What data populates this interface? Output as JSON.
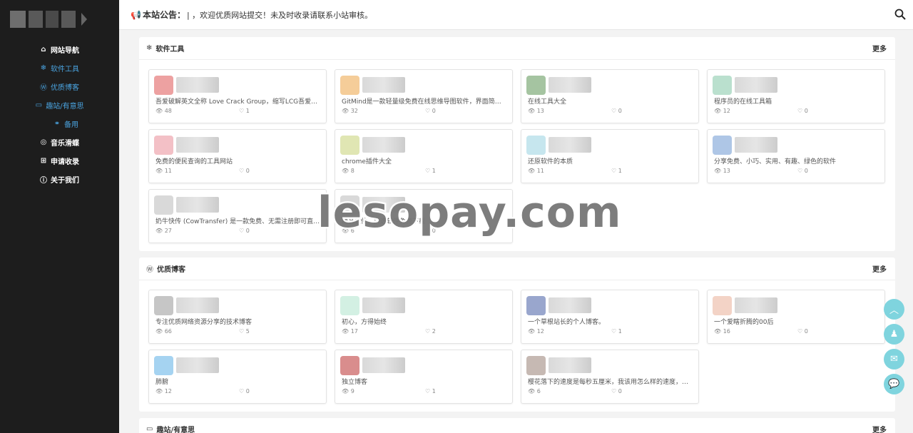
{
  "sidebar": {
    "items": [
      {
        "icon": "home-icon",
        "glyph": "🏠",
        "label": "网站导航"
      },
      {
        "icon": "snowflake-icon",
        "glyph": "❄",
        "label": "软件工具"
      },
      {
        "icon": "wordpress-icon",
        "glyph": "Ⓦ",
        "label": "优质博客"
      },
      {
        "icon": "monitor-icon",
        "glyph": "🖥",
        "label": "趣站/有意思"
      },
      {
        "icon": "link-icon",
        "glyph": "🔗",
        "label": "备用"
      },
      {
        "icon": "gamepad-icon",
        "glyph": "🎮",
        "label": "音乐滑蝶"
      },
      {
        "icon": "plus-square-icon",
        "glyph": "⊞",
        "label": "申请收录"
      },
      {
        "icon": "info-icon",
        "glyph": "ℹ",
        "label": "关于我们"
      }
    ]
  },
  "topbar": {
    "announcement_label": "本站公告：",
    "announcement_text": "| ，欢迎优质网站提交！未及时收录请联系小站审核。"
  },
  "sections": [
    {
      "title": "软件工具",
      "more": "更多",
      "cards": [
        {
          "desc": "吾爱破解英文全称 Love Crack Group，缩写LCG吾爱破…",
          "views": "48",
          "likes": "1",
          "color": "#e88a8a"
        },
        {
          "desc": "GitMind是一款轻量级免费在线思维导图软件，界面简洁…",
          "views": "32",
          "likes": "0",
          "color": "#f2c080"
        },
        {
          "desc": "在线工具大全",
          "views": "13",
          "likes": "0",
          "color": "#8fb58a"
        },
        {
          "desc": "程序员的在线工具箱",
          "views": "12",
          "likes": "0",
          "color": "#a9d8c2"
        },
        {
          "desc": "免费的便民查询的工具网站",
          "views": "11",
          "likes": "0",
          "color": "#f0b0b8"
        },
        {
          "desc": "chrome插件大全",
          "views": "8",
          "likes": "1",
          "color": "#d8e0a0"
        },
        {
          "desc": "还原软件的本质",
          "views": "11",
          "likes": "1",
          "color": "#b8e0ea"
        },
        {
          "desc": "分享免费、小巧、实用、有趣、绿色的软件",
          "views": "13",
          "likes": "0",
          "color": "#9ab8e0"
        },
        {
          "desc": "奶牛快传 (CowTransfer) 是一款免费、无需注册即可直接…",
          "views": "27",
          "likes": "0",
          "color": "#d0d0d0"
        },
        {
          "desc": "精品软件，挑选软件免费下载",
          "views": "6",
          "likes": "0",
          "color": "#cfcfcf"
        }
      ]
    },
    {
      "title": "优质博客",
      "more": "更多",
      "cards": [
        {
          "desc": "专注优质网络资源分享的技术博客",
          "views": "66",
          "likes": "5",
          "color": "#b8b8b8"
        },
        {
          "desc": "初心，方得始终",
          "views": "17",
          "likes": "2",
          "color": "#c8ecdc"
        },
        {
          "desc": "一个草根站长的个人博客。",
          "views": "12",
          "likes": "1",
          "color": "#8090c0"
        },
        {
          "desc": "一个爱瞎折腾的00后",
          "views": "16",
          "likes": "0",
          "color": "#f0c8b8"
        },
        {
          "desc": "肺腑",
          "views": "12",
          "likes": "0",
          "color": "#8ec8ee"
        },
        {
          "desc": "独立博客",
          "views": "9",
          "likes": "1",
          "color": "#d07070"
        },
        {
          "desc": "樱花落下的速度是每秒五厘米，我该用怎么样的速度，才…",
          "views": "6",
          "likes": "0",
          "color": "#b8a8a0"
        }
      ]
    },
    {
      "title": "趣站/有意思",
      "more": "更多",
      "cards": []
    }
  ],
  "watermark": "lesopay.com",
  "floating": [
    "arrow-up-icon",
    "qq-icon",
    "mail-icon",
    "wechat-icon"
  ]
}
